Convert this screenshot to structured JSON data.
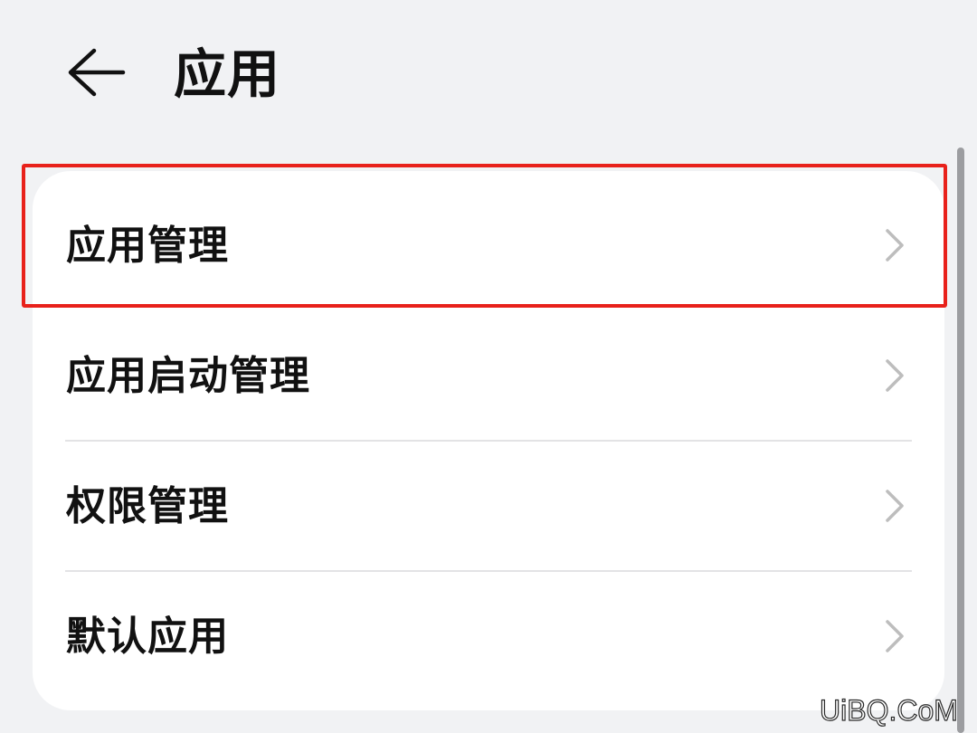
{
  "header": {
    "back_icon": "back-arrow-icon",
    "title": "应用"
  },
  "list": {
    "items": [
      {
        "label": "应用管理",
        "icon": "chevron-right-icon",
        "highlighted": true
      },
      {
        "label": "应用启动管理",
        "icon": "chevron-right-icon",
        "highlighted": false
      },
      {
        "label": "权限管理",
        "icon": "chevron-right-icon",
        "highlighted": false
      },
      {
        "label": "默认应用",
        "icon": "chevron-right-icon",
        "highlighted": false
      }
    ]
  },
  "colors": {
    "background": "#f1f2f4",
    "card": "#ffffff",
    "highlight": "#e8211b",
    "chevron": "#bdbdbd",
    "divider": "#e3e3e5",
    "scrollbar": "#9c9da0"
  },
  "watermark": {
    "text": "UiBQ.CoM"
  }
}
